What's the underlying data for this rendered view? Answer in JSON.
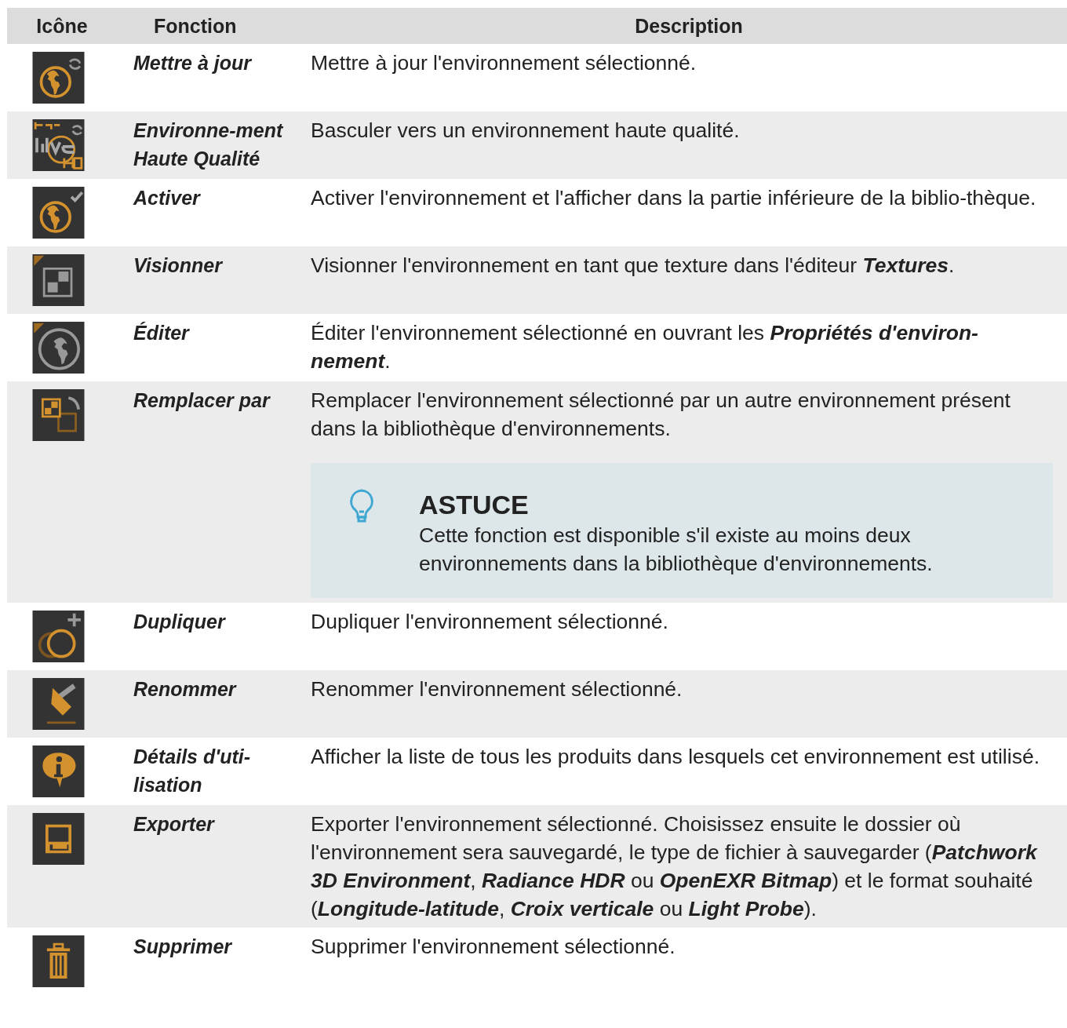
{
  "table": {
    "columns": [
      "Icône",
      "Fonction",
      "Description"
    ],
    "rows": [
      {
        "function": "Mettre à jour",
        "description": "Mettre à jour l'environnement sélectionné."
      },
      {
        "function": "Environne-ment Haute Qualité",
        "description": "Basculer vers un environnement haute qualité."
      },
      {
        "function": "Activer",
        "description": "Activer l'environnement et l'afficher dans la partie inférieure de la biblio-thèque."
      },
      {
        "function": "Visionner",
        "description": "Visionner l'environnement en tant que texture dans l'éditeur **Textures**."
      },
      {
        "function": "Éditer",
        "description": "Éditer l'environnement sélectionné en ouvrant les **Propriétés d'environ-nement**."
      },
      {
        "function": "Remplacer par",
        "description": "Remplacer l'environnement sélectionné par un autre environnement présent dans la bibliothèque d'environnements.",
        "tip": {
          "title": "ASTUCE",
          "text": "Cette fonction est disponible s'il existe au moins deux environnements dans la bibliothèque d'environnements."
        }
      },
      {
        "function": "Dupliquer",
        "description": "Dupliquer l'environnement sélectionné."
      },
      {
        "function": "Renommer",
        "description": "Renommer l'environnement sélectionné."
      },
      {
        "function": "Détails d'uti-lisation",
        "description": "Afficher la liste de tous les produits dans lesquels cet environnement est utilisé."
      },
      {
        "function": "Exporter",
        "description": "Exporter l'environnement sélectionné. Choisissez ensuite le dossier où l'environnement sera sauvegardé, le type de fichier à sauvegarder (**Patchwork 3D Environment**, **Radiance HDR** ou **OpenEXR Bitmap**) et le format souhaité (**Longitude-latitude**, **Croix verticale** ou **Light Probe**)."
      },
      {
        "function": "Supprimer",
        "description": "Supprimer l'environnement sélectionné."
      }
    ]
  }
}
